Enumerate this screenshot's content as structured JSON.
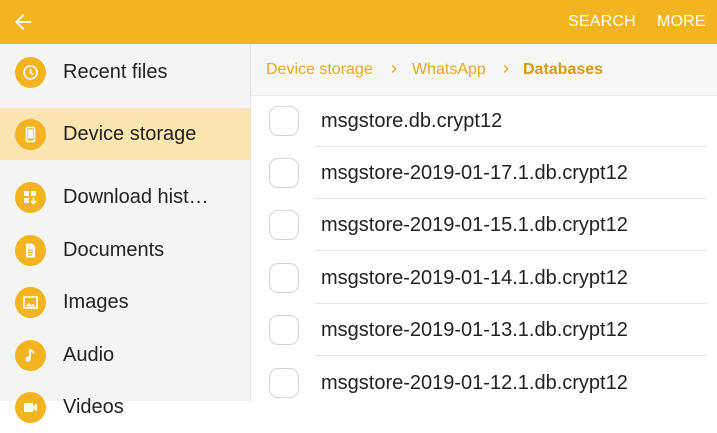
{
  "appbar": {
    "back_icon": "arrow-left-icon",
    "actions": [
      "SEARCH",
      "MORE"
    ],
    "color": "#f2b51f"
  },
  "sidebar": {
    "items": [
      {
        "label": "Recent files",
        "icon": "clock-icon"
      },
      {
        "label": "Device storage",
        "icon": "phone-icon",
        "selected": true
      },
      {
        "label": "Download hist…",
        "icon": "download-history-icon"
      },
      {
        "label": "Documents",
        "icon": "document-icon"
      },
      {
        "label": "Images",
        "icon": "image-icon"
      },
      {
        "label": "Audio",
        "icon": "music-note-icon"
      },
      {
        "label": "Videos",
        "icon": "video-icon"
      }
    ]
  },
  "breadcrumb": [
    "Device storage",
    "WhatsApp",
    "Databases"
  ],
  "files": [
    "msgstore.db.crypt12",
    "msgstore-2019-01-17.1.db.crypt12",
    "msgstore-2019-01-15.1.db.crypt12",
    "msgstore-2019-01-14.1.db.crypt12",
    "msgstore-2019-01-13.1.db.crypt12",
    "msgstore-2019-01-12.1.db.crypt12"
  ]
}
